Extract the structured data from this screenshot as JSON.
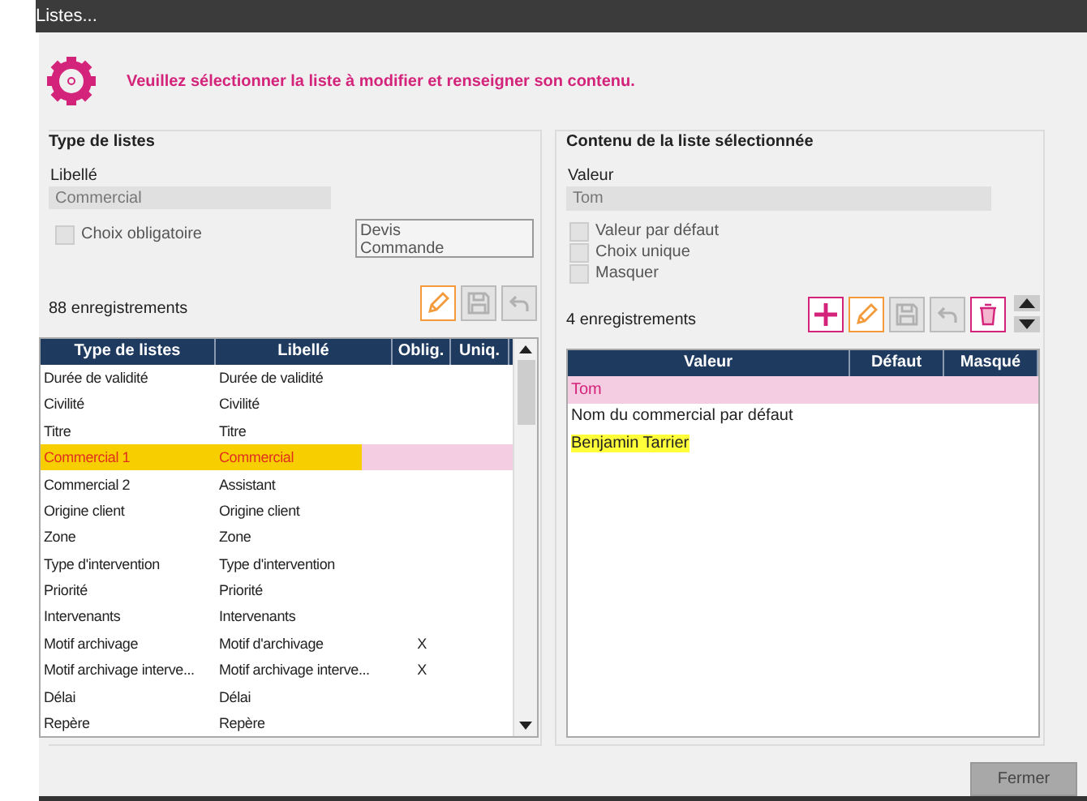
{
  "window": {
    "title": "Listes..."
  },
  "message": "Veuillez sélectionner la liste à modifier et renseigner son contenu.",
  "left_panel": {
    "title": "Type de listes",
    "field_label": "Libellé",
    "field_value": "Commercial",
    "checkbox": {
      "label": "Choix obligatoire",
      "checked": false
    },
    "listbox": [
      "Devis",
      "Commande"
    ],
    "count": "88 enregistrements",
    "toolbar": [
      {
        "kind": "edit",
        "disabled": false
      },
      {
        "kind": "save",
        "disabled": true
      },
      {
        "kind": "undo",
        "disabled": true
      }
    ],
    "table": {
      "columns": [
        "Type de listes",
        "Libellé",
        "Oblig.",
        "Uniq."
      ],
      "rows": [
        {
          "type": "Durée de validité",
          "label": "Durée de validité",
          "selected": false,
          "highlighted": false
        },
        {
          "type": "Civilité",
          "label": "Civilité",
          "selected": false,
          "highlighted": false
        },
        {
          "type": "Titre",
          "label": "Titre",
          "selected": false,
          "highlighted": false
        },
        {
          "type": "Commercial 1",
          "label": "Commercial",
          "selected": true,
          "highlighted": true
        },
        {
          "type": "Commercial 2",
          "label": "Assistant",
          "selected": false,
          "highlighted": false
        },
        {
          "type": "Origine client",
          "label": "Origine client",
          "selected": false,
          "highlighted": false
        },
        {
          "type": "Zone",
          "label": "Zone",
          "selected": false,
          "highlighted": false
        },
        {
          "type": "Type d'intervention",
          "label": "Type d'intervention",
          "selected": false,
          "highlighted": false
        },
        {
          "type": "Priorité",
          "label": "Priorité",
          "selected": false,
          "highlighted": false
        },
        {
          "type": "Intervenants",
          "label": "Intervenants",
          "selected": false,
          "highlighted": false
        },
        {
          "type": "Motif archivage",
          "label": "Motif d'archivage",
          "oblig": "X",
          "selected": false,
          "highlighted": false
        },
        {
          "type": "Motif archivage interve...",
          "label": "Motif archivage interve...",
          "oblig": "X",
          "selected": false,
          "highlighted": false
        },
        {
          "type": "Délai",
          "label": "Délai",
          "selected": false,
          "highlighted": false
        },
        {
          "type": "Repère",
          "label": "Repère",
          "selected": false,
          "highlighted": false
        }
      ]
    }
  },
  "right_panel": {
    "title": "Contenu de la liste sélectionnée",
    "field_label": "Valeur",
    "field_value": "Tom",
    "checkboxes": [
      {
        "label": "Valeur par défaut",
        "checked": false
      },
      {
        "label": "Choix unique",
        "checked": false
      },
      {
        "label": "Masquer",
        "checked": false
      }
    ],
    "count": "4 enregistrements",
    "toolbar": [
      {
        "kind": "add",
        "disabled": false
      },
      {
        "kind": "edit",
        "disabled": false
      },
      {
        "kind": "save",
        "disabled": true
      },
      {
        "kind": "undo",
        "disabled": true
      },
      {
        "kind": "delete",
        "disabled": false
      }
    ],
    "table": {
      "columns": [
        "Valeur",
        "Défaut",
        "Masqué"
      ],
      "rows": [
        {
          "value": "Tom",
          "selected": true,
          "highlighted": false
        },
        {
          "value": "Nom du commercial par défaut",
          "selected": false,
          "highlighted": false
        },
        {
          "value": "Benjamin Tarrier",
          "selected": false,
          "highlighted": true
        }
      ]
    }
  },
  "buttons": [
    {
      "label": "Fermer",
      "disabled": true
    }
  ]
}
